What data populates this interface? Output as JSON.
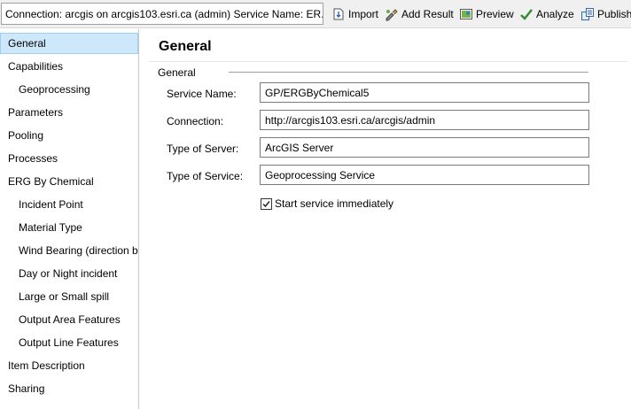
{
  "toolbar": {
    "connection_text": "Connection: arcgis on arcgis103.esri.ca (admin)   Service Name: ER...",
    "buttons": {
      "import": "Import",
      "add_result": "Add Result",
      "preview": "Preview",
      "analyze": "Analyze",
      "publish": "Publish"
    }
  },
  "sidebar": {
    "items": [
      {
        "label": "General"
      },
      {
        "label": "Capabilities"
      },
      {
        "label": "Geoprocessing"
      },
      {
        "label": "Parameters"
      },
      {
        "label": "Pooling"
      },
      {
        "label": "Processes"
      },
      {
        "label": "ERG By Chemical"
      },
      {
        "label": "Incident Point"
      },
      {
        "label": "Material Type"
      },
      {
        "label": "Wind Bearing (direction blo"
      },
      {
        "label": "Day or Night incident"
      },
      {
        "label": "Large or Small spill"
      },
      {
        "label": "Output Area Features"
      },
      {
        "label": "Output Line Features"
      },
      {
        "label": "Item Description"
      },
      {
        "label": "Sharing"
      }
    ],
    "selected": "General"
  },
  "main": {
    "title": "General",
    "group_label": "General",
    "fields": {
      "service_name": {
        "label": "Service Name:",
        "value": "GP/ERGByChemical5"
      },
      "connection": {
        "label": "Connection:",
        "value": "http://arcgis103.esri.ca/arcgis/admin"
      },
      "server_type": {
        "label": "Type of Server:",
        "value": "ArcGIS Server"
      },
      "service_type": {
        "label": "Type of Service:",
        "value": "Geoprocessing Service"
      }
    },
    "start_checkbox": {
      "label": "Start service immediately",
      "checked": true
    }
  },
  "colors": {
    "selected_bg": "#cde8fb",
    "selected_border": "#9ccff5",
    "toolbar_bg": "#f0f0f0",
    "check_green": "#2e8b2e"
  }
}
